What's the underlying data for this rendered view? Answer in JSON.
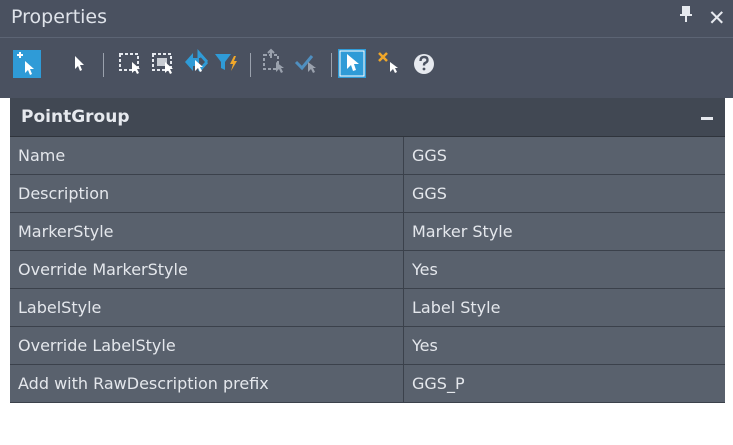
{
  "panel": {
    "title": "Properties",
    "pin_icon": "pin-icon",
    "close_icon": "close-icon"
  },
  "toolbar": {
    "buttons": [
      "add-to-selection-icon",
      "select-icon",
      "select-window-icon",
      "select-crossing-icon",
      "invert-selection-icon",
      "filter-select-icon",
      "select-similar-icon",
      "select-check-icon",
      "pickable-icon",
      "deselect-icon",
      "help-icon"
    ]
  },
  "group": {
    "title": "PointGroup",
    "collapse_symbol": "−"
  },
  "properties": [
    {
      "name": "Name",
      "value": "GGS"
    },
    {
      "name": "Description",
      "value": "GGS"
    },
    {
      "name": "MarkerStyle",
      "value": "Marker Style"
    },
    {
      "name": "Override MarkerStyle",
      "value": "Yes"
    },
    {
      "name": "LabelStyle",
      "value": "Label Style"
    },
    {
      "name": "Override LabelStyle",
      "value": "Yes"
    },
    {
      "name": "Add with RawDescription prefix",
      "value": "GGS_P"
    }
  ],
  "colors": {
    "titlebar": "#4a5160",
    "group_header": "#414853",
    "row": "#59616d",
    "text": "#e4e7ec",
    "accent_blue": "#2f9bd7",
    "filter_yellow": "#f0a72a"
  }
}
